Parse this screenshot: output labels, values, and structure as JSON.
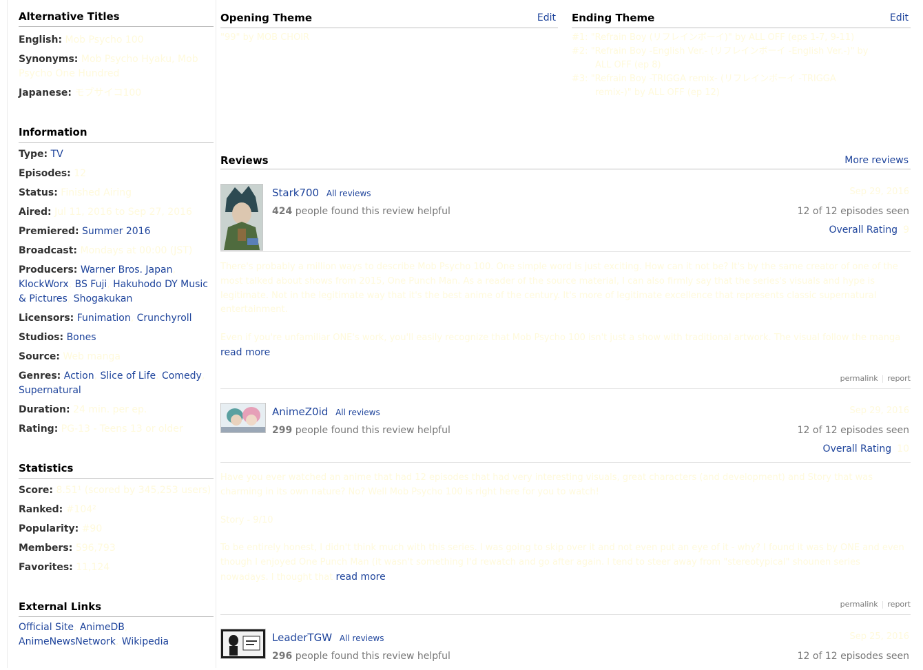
{
  "sidebar": {
    "alt_titles": {
      "heading": "Alternative Titles",
      "english_label": "English:",
      "english_value": "Mob Psycho 100",
      "synonyms_label": "Synonyms:",
      "synonyms_value": "Mob Psycho Hyaku, Mob Psycho One Hundred",
      "japanese_label": "Japanese:",
      "japanese_value": "モブサイコ100"
    },
    "information": {
      "heading": "Information",
      "type_label": "Type:",
      "type_value": "TV",
      "episodes_label": "Episodes:",
      "episodes_value": "12",
      "status_label": "Status:",
      "status_value": "Finished Airing",
      "aired_label": "Aired:",
      "aired_value": "Jul 11, 2016 to Sep 27, 2016",
      "premiered_label": "Premiered:",
      "premiered_value": "Summer 2016",
      "broadcast_label": "Broadcast:",
      "broadcast_value": "Mondays at 00:00 (JST)",
      "producers_label": "Producers:",
      "producers": [
        "Warner Bros. Japan",
        "KlockWorx",
        "BS Fuji",
        "Hakuhodo DY Music & Pictures",
        "Shogakukan"
      ],
      "licensors_label": "Licensors:",
      "licensors": [
        "Funimation",
        "Crunchyroll"
      ],
      "studios_label": "Studios:",
      "studios_value": "Bones",
      "source_label": "Source:",
      "source_value": "Web manga",
      "genres_label": "Genres:",
      "genres": [
        "Action",
        "Slice of Life",
        "Comedy",
        "Supernatural"
      ],
      "duration_label": "Duration:",
      "duration_value": "24 min. per ep.",
      "rating_label": "Rating:",
      "rating_value": "PG-13 - Teens 13 or older"
    },
    "statistics": {
      "heading": "Statistics",
      "score_label": "Score:",
      "score_value": "8.51¹ (scored by 345,253 users)",
      "ranked_label": "Ranked:",
      "ranked_value": "#104²",
      "popularity_label": "Popularity:",
      "popularity_value": "#90",
      "members_label": "Members:",
      "members_value": "596,793",
      "favorites_label": "Favorites:",
      "favorites_value": "11,124"
    },
    "external_links": {
      "heading": "External Links",
      "links": [
        "Official Site",
        "AnimeDB",
        "AnimeNewsNetwork",
        "Wikipedia"
      ]
    }
  },
  "themes": {
    "opening": {
      "heading": "Opening Theme",
      "edit_label": "Edit",
      "items": [
        "\"99\" by MOB CHOIR"
      ]
    },
    "ending": {
      "heading": "Ending Theme",
      "edit_label": "Edit",
      "items": [
        {
          "prefix": "#1:",
          "text": "\"Refrain Boy (リフレインボーイ)\" by ALL OFF (eps 1-7, 9-11)",
          "cont": ""
        },
        {
          "prefix": "#2:",
          "text": "\"Refrain Boy -English Ver.- (リフレインボーイ -English Ver.-)\" by",
          "cont": "ALL OFF (ep 8)"
        },
        {
          "prefix": "#3:",
          "text": "\"Refrain Boy -TRIGGA remix- (リフレインボーイ -TRIGGA",
          "cont": "remix-)\" by ALL OFF (ep 12)"
        }
      ]
    }
  },
  "reviews": {
    "heading": "Reviews",
    "more_label": "More reviews",
    "all_reviews_label": "All reviews",
    "helpful_suffix": "people found this review helpful",
    "overall_label": "Overall Rating",
    "read_more_label": "read more",
    "permalink_label": "permalink",
    "report_label": "report",
    "items": [
      {
        "user": "Stark700",
        "helpful_count": "424",
        "date": "Sep 29, 2016",
        "episodes": "12 of 12 episodes seen",
        "rating": "9",
        "paragraphs": [
          "There's probably a million ways to describe Mob Psycho 100. One simple word is just exciting. How can it not be? It's by the same creator of one of the most talked about shows from 2015, One Punch Man. As a reader of the source material, I can also firmly say that the series's visuals and hype is legitimate. Not in the legitimate way that it's the best anime of the century. It's more of legitimate excellence that represents classic supernatural entertainment.",
          "Even if you're unfamiliar ONE's work, you'll easily recognize that Mob Psycho 100 isn't just a show with traditional artwork. The visual follow the manga"
        ]
      },
      {
        "user": "AnimeZ0id",
        "helpful_count": "299",
        "date": "Sep 29, 2016",
        "episodes": "12 of 12 episodes seen",
        "rating": "10",
        "paragraphs": [
          "Have you ever watched an anime that had 12 episodes that had very interesting visuals, great characters (and development) and Story that was charming in its own nature? No? Well Mob Psycho 100 is right here for you to watch!",
          "Story - 9/10",
          "To be entirely honest, I didn't think much with this series. I was going to skip over it and not even put an eye of it - why? I found it was by ONE and even though I enjoyed One Punch Man (it wasn't something I'd rewatch and go after again. I tend to steer away from \"stereotypical\" shounen series nowadays. I thought that"
        ]
      },
      {
        "user": "LeaderTGW",
        "helpful_count": "296",
        "date": "Sep 25, 2016",
        "episodes": "12 of 12 episodes seen",
        "rating": "",
        "paragraphs": []
      }
    ]
  },
  "colors": {
    "link": "#1d439b",
    "faint_text": "#fffadc",
    "muted": "#787878",
    "heading_rule": "#bebebe"
  }
}
